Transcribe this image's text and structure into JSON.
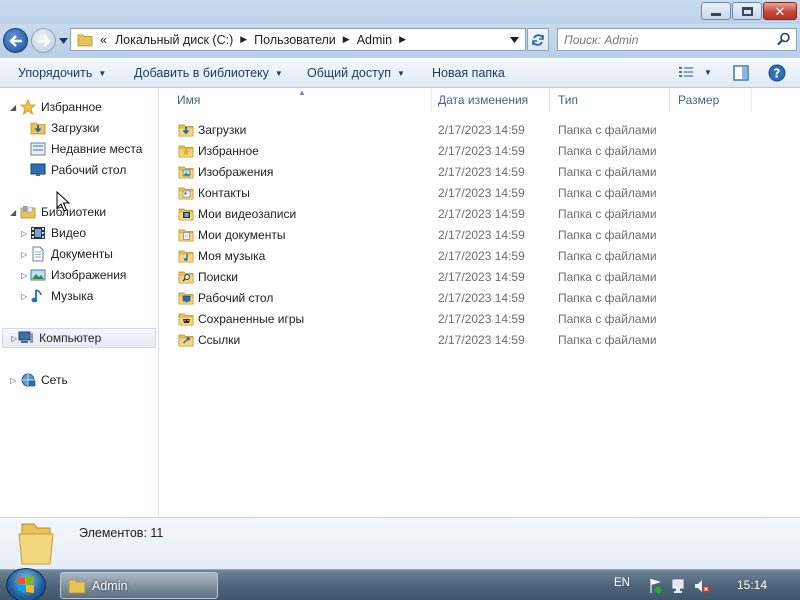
{
  "window": {
    "buttons": {
      "minimize": "minimize",
      "maximize": "maximize",
      "close": "close"
    }
  },
  "address": {
    "overflow_glyph": "«",
    "breadcrumbs": [
      "Локальный диск (C:)",
      "Пользователи",
      "Admin"
    ],
    "separator": "›",
    "search_placeholder": "Поиск: Admin"
  },
  "toolbar": {
    "organize": "Упорядочить",
    "add_to_library": "Добавить в библиотеку",
    "share": "Общий доступ",
    "new_folder": "Новая папка"
  },
  "navigation": {
    "favorites": {
      "label": "Избранное",
      "items": [
        "Загрузки",
        "Недавние места",
        "Рабочий стол"
      ]
    },
    "libraries": {
      "label": "Библиотеки",
      "items": [
        "Видео",
        "Документы",
        "Изображения",
        "Музыка"
      ]
    },
    "computer": "Компьютер",
    "network": "Сеть"
  },
  "columns": {
    "name": "Имя",
    "date": "Дата изменения",
    "type": "Тип",
    "size": "Размер"
  },
  "files": [
    {
      "name": "Загрузки",
      "date": "2/17/2023 14:59",
      "type": "Папка с файлами",
      "icon": "downloads-folder-icon"
    },
    {
      "name": "Избранное",
      "date": "2/17/2023 14:59",
      "type": "Папка с файлами",
      "icon": "favorites-folder-icon"
    },
    {
      "name": "Изображения",
      "date": "2/17/2023 14:59",
      "type": "Папка с файлами",
      "icon": "pictures-folder-icon"
    },
    {
      "name": "Контакты",
      "date": "2/17/2023 14:59",
      "type": "Папка с файлами",
      "icon": "contacts-folder-icon"
    },
    {
      "name": "Мои видеозаписи",
      "date": "2/17/2023 14:59",
      "type": "Папка с файлами",
      "icon": "videos-folder-icon"
    },
    {
      "name": "Мои документы",
      "date": "2/17/2023 14:59",
      "type": "Папка с файлами",
      "icon": "documents-folder-icon"
    },
    {
      "name": "Моя музыка",
      "date": "2/17/2023 14:59",
      "type": "Папка с файлами",
      "icon": "music-folder-icon"
    },
    {
      "name": "Поиски",
      "date": "2/17/2023 14:59",
      "type": "Папка с файлами",
      "icon": "searches-folder-icon"
    },
    {
      "name": "Рабочий стол",
      "date": "2/17/2023 14:59",
      "type": "Папка с файлами",
      "icon": "desktop-folder-icon"
    },
    {
      "name": "Сохраненные игры",
      "date": "2/17/2023 14:59",
      "type": "Папка с файлами",
      "icon": "saved-games-folder-icon"
    },
    {
      "name": "Ссылки",
      "date": "2/17/2023 14:59",
      "type": "Папка с файлами",
      "icon": "links-folder-icon"
    }
  ],
  "details": {
    "count_text": "Элементов: 11"
  },
  "taskbar": {
    "task_label": "Admin",
    "language": "EN",
    "time": "15:14"
  },
  "colors": {
    "accent": "#1e395b",
    "folder": "#e8c25a",
    "taskbar": "#4e657a"
  }
}
